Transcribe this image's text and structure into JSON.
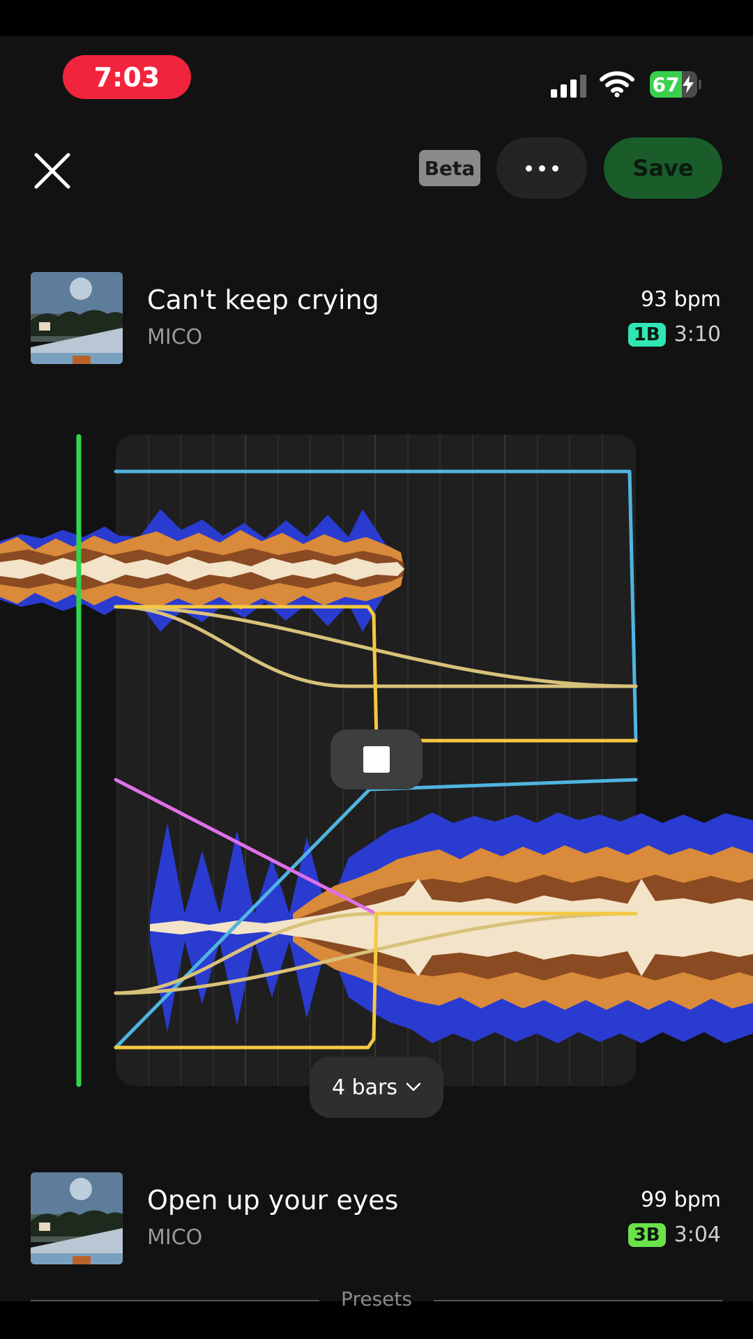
{
  "status_bar": {
    "time": "7:03",
    "battery_level": 67,
    "battery_text": "67",
    "icons": [
      "cellular-signal-icon",
      "wifi-icon",
      "battery-charging-icon"
    ]
  },
  "toolbar": {
    "close_icon": "close-icon",
    "beta_label": "Beta",
    "more_icon": "more-horizontal-icon",
    "save_label": "Save"
  },
  "track_a": {
    "title": "Can't keep crying",
    "artist": "MICO",
    "bpm": "93 bpm",
    "key": "1B",
    "key_color": "#2fe6b4",
    "duration": "3:10"
  },
  "track_b": {
    "title": "Open up your eyes",
    "artist": "MICO",
    "bpm": "99 bpm",
    "key": "3B",
    "key_color": "#6be24a",
    "duration": "3:04"
  },
  "editor": {
    "playhead_color": "#2fd64b",
    "curve_colors": {
      "volume": "#f5c842",
      "eq": "#d8c27a",
      "filter": "#4fb4e0",
      "echo": "#e070e8"
    },
    "waveform_colors": [
      "#f3e3c8",
      "#d98a3a",
      "#8a4a22",
      "#2a3bd0"
    ],
    "stop_icon": "stop-icon",
    "length_label": "4 bars",
    "length_icon": "chevron-down-icon"
  },
  "footer": {
    "presets_label": "Presets"
  }
}
